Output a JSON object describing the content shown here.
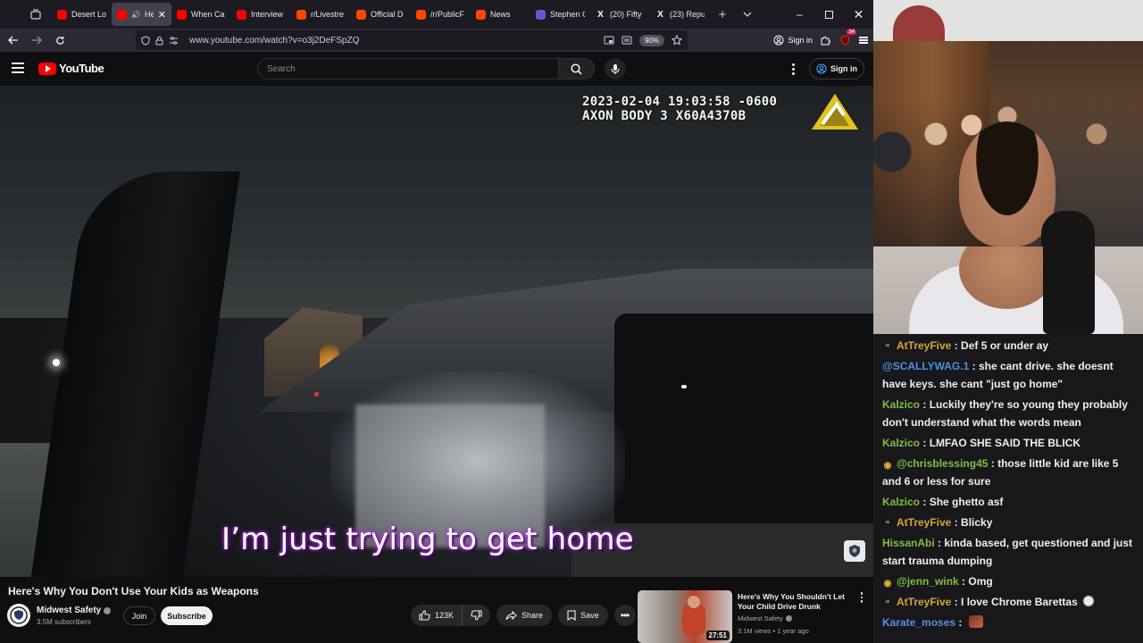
{
  "browser": {
    "tabs": [
      {
        "label": "Desert Lo",
        "icon": "youtube-favicon-icon",
        "active": false
      },
      {
        "label": "He",
        "icon": "youtube-favicon-icon",
        "active": true
      },
      {
        "label": "When Ca",
        "icon": "youtube-favicon-icon",
        "active": false
      },
      {
        "label": "Interview",
        "icon": "youtube-favicon-icon",
        "active": false
      },
      {
        "label": "r/Livestre",
        "icon": "reddit-favicon-icon",
        "active": false
      },
      {
        "label": "Official D",
        "icon": "reddit-favicon-icon",
        "active": false
      },
      {
        "label": "/r/PublicF",
        "icon": "reddit-favicon-icon",
        "active": false
      },
      {
        "label": "News",
        "icon": "reddit-favicon-icon",
        "active": false
      },
      {
        "label": "Stephen C",
        "icon": "nbc-favicon-icon",
        "active": false
      },
      {
        "label": "(20) Fifty",
        "icon": "x-favicon-icon",
        "active": false
      },
      {
        "label": "(23) Repu",
        "icon": "x-favicon-icon",
        "active": false
      }
    ],
    "url": "www.youtube.com/watch?v=o3j2DeFSpZQ",
    "zoom": "90%",
    "signin_label": "Sign in",
    "extension_count": "34"
  },
  "youtube": {
    "logo_text": "YouTube",
    "search_placeholder": "Search",
    "signin_label": "Sign in",
    "video": {
      "timestamp_line1": "2023-02-04 19:03:58 -0600",
      "timestamp_line2": "AXON BODY 3 X60A4370B",
      "caption": "I’m just trying to get home"
    },
    "title": "Here's Why You Don't Use Your Kids as Weapons",
    "channel": "Midwest Safety",
    "subscribers": "3.5M subscribers",
    "join_label": "Join",
    "subscribe_label": "Subscribe",
    "likes": "123K",
    "share_label": "Share",
    "save_label": "Save",
    "recommended": {
      "title": "Here's Why You Shouldn't Let Your Child Drive Drunk",
      "channel": "Midwest Safety",
      "meta": "3.1M views • 1 year ago",
      "duration": "27:51"
    }
  },
  "chat": [
    {
      "badge": "quote",
      "user": "AtTreyFive",
      "color": "#d9a338",
      "text": "Def 5 or under ay"
    },
    {
      "badge": "",
      "user": "@SCALLYWAG.1",
      "color": "#4a90e2",
      "text": "she cant drive. she doesnt have keys. she cant \"just go home\""
    },
    {
      "badge": "",
      "user": "Kalzico",
      "color": "#7fbf3f",
      "text": "Luckily they're so young they probably don't understand what the words mean"
    },
    {
      "badge": "",
      "user": "Kalzico",
      "color": "#7fbf3f",
      "text": "LMFAO SHE SAID THE BLICK"
    },
    {
      "badge": "circle",
      "user": "@chrisblessing45",
      "color": "#7fbf3f",
      "text": "those little kid are like 5 and 6 or less for sure"
    },
    {
      "badge": "",
      "user": "Kalzico",
      "color": "#7fbf3f",
      "text": "She ghetto asf"
    },
    {
      "badge": "quote",
      "user": "AtTreyFive",
      "color": "#d9a338",
      "text": "Blicky"
    },
    {
      "badge": "",
      "user": "HissanAbi",
      "color": "#7fbf3f",
      "text": "kinda based, get questioned and just start trauma dumping"
    },
    {
      "badge": "circle",
      "user": "@jenn_wink",
      "color": "#7fbf3f",
      "text": "Omg"
    },
    {
      "badge": "quote",
      "user": "AtTreyFive",
      "color": "#d9a338",
      "text": "I love Chrome Barettas"
    },
    {
      "badge": "",
      "user": "Karate_moses",
      "color": "#5b8de0",
      "text": ""
    }
  ]
}
